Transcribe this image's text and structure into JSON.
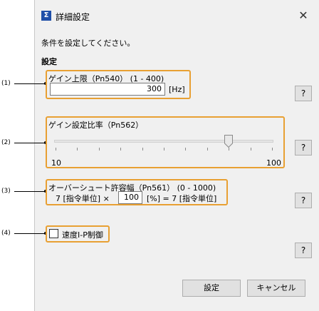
{
  "window": {
    "icon_text": "Σ",
    "title": "詳細設定",
    "close_glyph": "✕"
  },
  "instruction": "条件を設定してください。",
  "section_title": "設定",
  "callouts": [
    "(1)",
    "(2)",
    "(3)",
    "(4)"
  ],
  "gain_limit": {
    "label": "ゲイン上限（Pn540） (1 - 400)",
    "value": "300",
    "unit": "[Hz]"
  },
  "gain_ratio": {
    "label": "ゲイン設定比率（Pn562）",
    "min_label": "10",
    "max_label": "100",
    "slider_fraction": 0.8
  },
  "overshoot": {
    "label": "オーバーシュート許容幅（Pn561） (0 - 1000)",
    "left_value": "7 [指令単位] ×",
    "value": "100",
    "right_value": "[%] = 7 [指令単位]"
  },
  "speed_ip": {
    "label": "速度I-P制御",
    "checked": false
  },
  "help_label": "?",
  "buttons": {
    "ok": "設定",
    "cancel": "キャンセル"
  }
}
